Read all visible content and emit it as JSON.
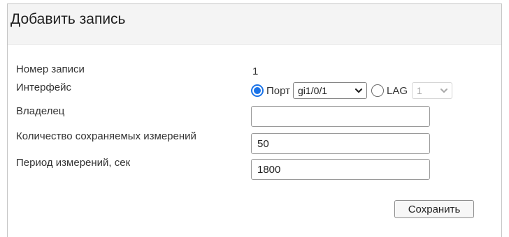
{
  "dialog": {
    "title": "Добавить запись"
  },
  "form": {
    "record_number": {
      "label": "Номер записи",
      "value": "1"
    },
    "interface": {
      "label": "Интерфейс",
      "port_option": {
        "label": "Порт",
        "selected": true,
        "select_value": "gi1/0/1"
      },
      "lag_option": {
        "label": "LAG",
        "selected": false,
        "select_value": "1"
      }
    },
    "owner": {
      "label": "Владелец",
      "value": ""
    },
    "stored_measurements": {
      "label": "Количество сохраняемых измерений",
      "value": "50"
    },
    "measurement_period": {
      "label": "Период измерений, сек",
      "value": "1800"
    }
  },
  "actions": {
    "save_label": "Сохранить"
  },
  "colors": {
    "radio_accent": "#1a73e8",
    "header_bg": "#f4f4f4"
  },
  "icons": {
    "select_arrow": "chevron-down-icon"
  }
}
